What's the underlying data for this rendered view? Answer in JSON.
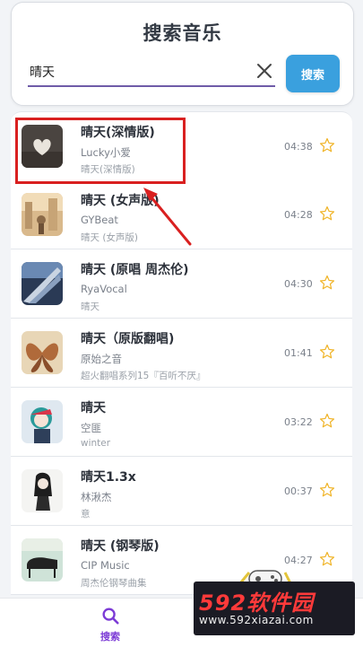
{
  "header": {
    "title": "搜索音乐",
    "search_value": "晴天",
    "search_button_label": "搜索"
  },
  "songs": [
    {
      "title": "晴天(深情版)",
      "artist": "Lucky小爱",
      "album": "晴天(深情版)",
      "duration": "04:38",
      "cover_icon": "heart-cover-icon"
    },
    {
      "title": "晴天 (女声版)",
      "artist": "GYBeat",
      "album": "晴天 (女声版)",
      "duration": "04:28",
      "cover_icon": "street-photo-cover-icon"
    },
    {
      "title": "晴天 (原唱 周杰伦)",
      "artist": "RyaVocal",
      "album": "晴天",
      "duration": "04:30",
      "cover_icon": "wing-cover-icon"
    },
    {
      "title": "晴天（原版翻唱)",
      "artist": "原始之音",
      "album": "超火翻唱系列15『百听不厌』",
      "duration": "01:41",
      "cover_icon": "butterfly-cover-icon"
    },
    {
      "title": "晴天",
      "artist": "空匪",
      "album": "winter",
      "duration": "03:22",
      "cover_icon": "anime-girl-cover-icon"
    },
    {
      "title": "晴天1.3x",
      "artist": "林湫杰",
      "album": "意",
      "duration": "00:37",
      "cover_icon": "sketch-girl-cover-icon"
    },
    {
      "title": "晴天 (钢琴版)",
      "artist": "CIP Music",
      "album": "周杰伦钢琴曲集",
      "duration": "04:27",
      "cover_icon": "piano-cover-icon"
    }
  ],
  "tab_bar": {
    "search_label": "搜索"
  },
  "watermark": {
    "main": "592软件园",
    "sub": "www.592xiazai.com"
  },
  "colors": {
    "accent": "#3aa0de",
    "tab_active": "#7c3bd6",
    "highlight": "#d92020",
    "star": "#f0b428"
  }
}
